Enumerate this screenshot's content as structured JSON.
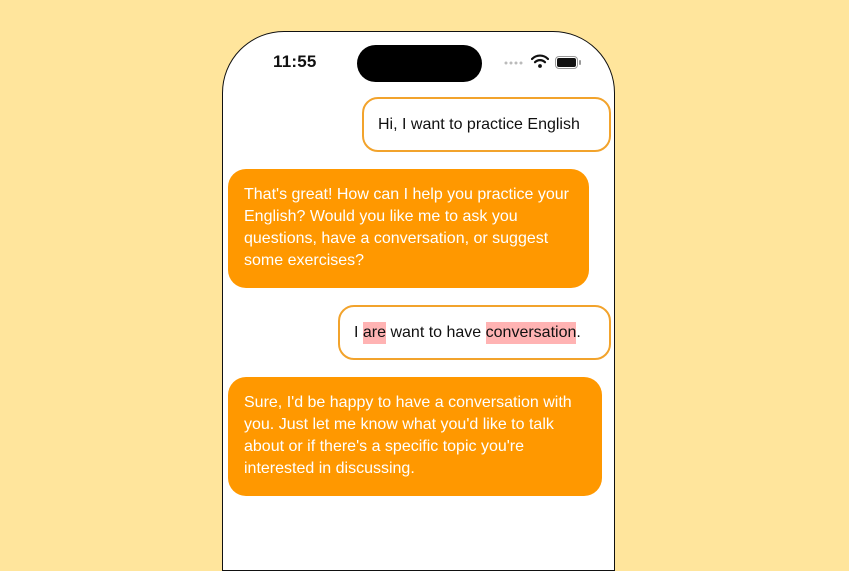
{
  "status_bar": {
    "time": "11:55"
  },
  "messages": [
    {
      "role": "user",
      "text": "Hi, I want to practice English"
    },
    {
      "role": "assistant",
      "text": "That's great! How can I help you practice your English? Would you like me to ask you questions, have a conversation, or suggest some exercises?"
    },
    {
      "role": "user",
      "parts": [
        "I ",
        "are",
        " want to have ",
        "conversation",
        "."
      ]
    },
    {
      "role": "assistant",
      "text": "Sure, I'd be happy to have a conversation with you. Just let me know what you'd like to talk about or if there's a specific topic you're interested in discussing."
    }
  ],
  "colors": {
    "background": "#FFE59C",
    "assistant_bubble": "#FF9800",
    "user_bubble_border": "#F2A32C",
    "error_highlight": "#FFB3B3"
  },
  "icons": [
    "signal-icon",
    "wifi-icon",
    "battery-icon"
  ]
}
